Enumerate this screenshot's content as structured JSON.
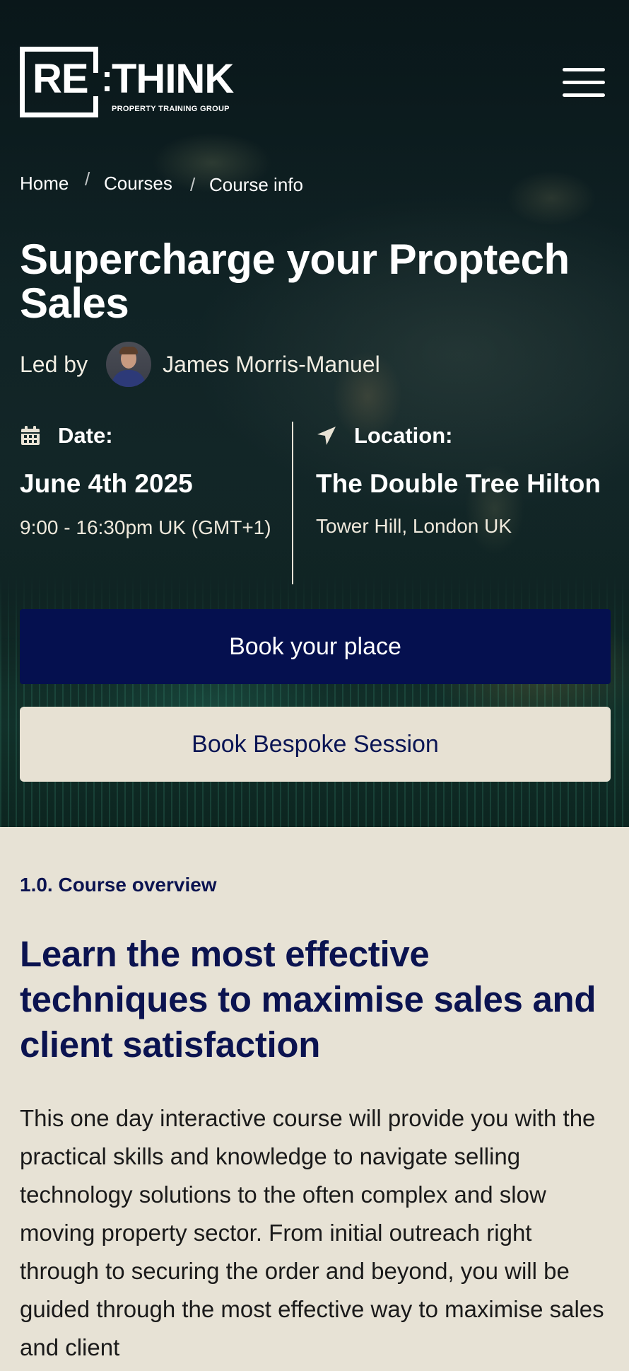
{
  "brand": {
    "name_part1": "RE",
    "name_part2": "THINK",
    "tagline": "PROPERTY TRAINING GROUP"
  },
  "header": {
    "menu_icon": "hamburger-menu-icon"
  },
  "breadcrumb": {
    "items": [
      {
        "label": "Home"
      },
      {
        "label": "Courses"
      },
      {
        "label": "Course info"
      }
    ],
    "separator": "/"
  },
  "course": {
    "title": "Supercharge your Proptech Sales",
    "led_by_label": "Led by",
    "instructor": "James Morris-Manuel",
    "date": {
      "icon": "calendar-icon",
      "label": "Date:",
      "value": "June 4th 2025",
      "time": "9:00 - 16:30pm UK (GMT+1)"
    },
    "location": {
      "icon": "location-arrow-icon",
      "label": "Location:",
      "venue": "The Double Tree Hilton",
      "address": "Tower Hill, London UK"
    },
    "book_button": "Book your place",
    "bespoke_button": "Book Bespoke Session"
  },
  "overview": {
    "label": "1.0. Course overview",
    "heading": "Learn the most effective techniques to maximise sales and client satisfaction",
    "body": "This one day interactive course will provide you with the practical skills and knowledge to navigate selling technology solutions to the often complex and slow moving property sector. From initial outreach right through to securing the order and beyond, you will be guided through the most effective way to maximise sales and client"
  },
  "colors": {
    "primary_navy": "#05104f",
    "cream": "#e7e2d5",
    "hero_dark": "#13282a",
    "white": "#ffffff"
  }
}
